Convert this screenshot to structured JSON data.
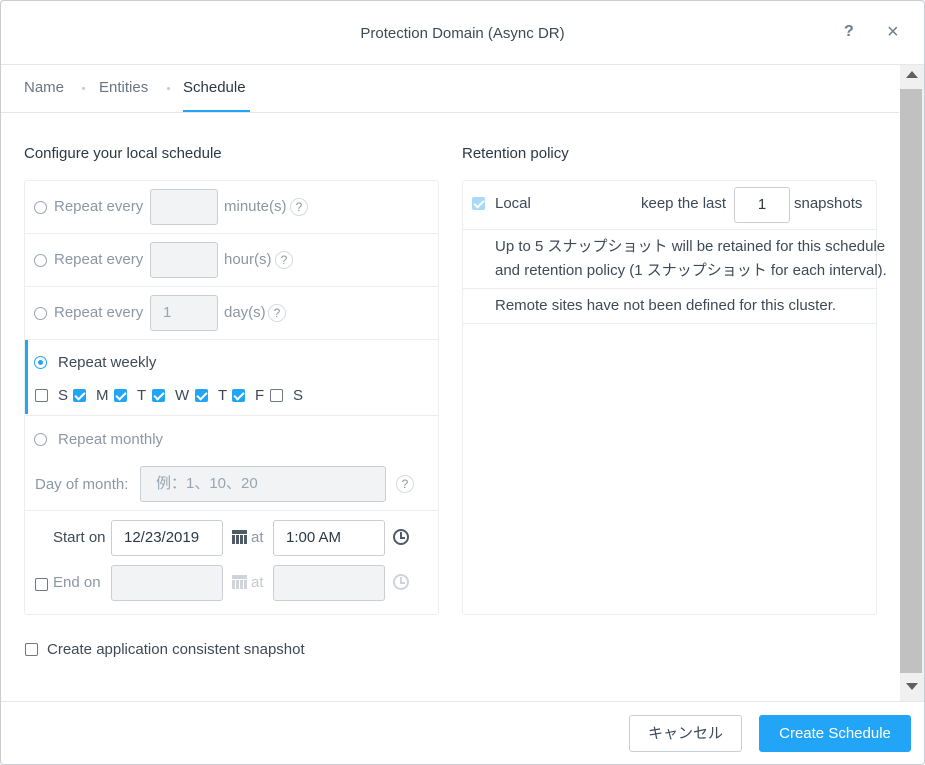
{
  "header": {
    "title": "Protection Domain (Async DR)",
    "help": "?",
    "close": "×"
  },
  "tabs": [
    {
      "label": "Name"
    },
    {
      "label": "Entities"
    },
    {
      "label": "Schedule"
    }
  ],
  "schedule": {
    "title": "Configure your local schedule",
    "repeat_label": "Repeat every",
    "minutes": {
      "value": "",
      "unit": "minute(s)"
    },
    "hours": {
      "value": "",
      "unit": "hour(s)"
    },
    "days": {
      "value": "1",
      "unit": "day(s)"
    },
    "weekly_label": "Repeat weekly",
    "days_of_week": [
      {
        "label": "S",
        "checked": false
      },
      {
        "label": "M",
        "checked": true
      },
      {
        "label": "T",
        "checked": true
      },
      {
        "label": "W",
        "checked": true
      },
      {
        "label": "T",
        "checked": true
      },
      {
        "label": "F",
        "checked": true
      },
      {
        "label": "S",
        "checked": false
      }
    ],
    "monthly_label": "Repeat monthly",
    "day_of_month_label": "Day of month:",
    "day_of_month_placeholder": "例：1、10、20",
    "start_label": "Start on",
    "start_date": "12/23/2019",
    "at_label": "at",
    "start_time": "1:00 AM",
    "end_label": "End on",
    "qmark": "?"
  },
  "app_consistent_label": "Create application consistent snapshot",
  "retention": {
    "title": "Retention policy",
    "local_label": "Local",
    "keep_label": "keep the last",
    "keep_value": "1",
    "snapshots_label": "snapshots",
    "info_line1": "Up to 5 スナップショット will be retained for this schedule",
    "info_line2": "and retention policy (1 スナップショット for each interval).",
    "remote_note": "Remote sites have not been defined for this cluster."
  },
  "footer": {
    "cancel_label": "キャンセル",
    "create_label": "Create Schedule"
  },
  "colors": {
    "accent": "#22a5f7"
  }
}
